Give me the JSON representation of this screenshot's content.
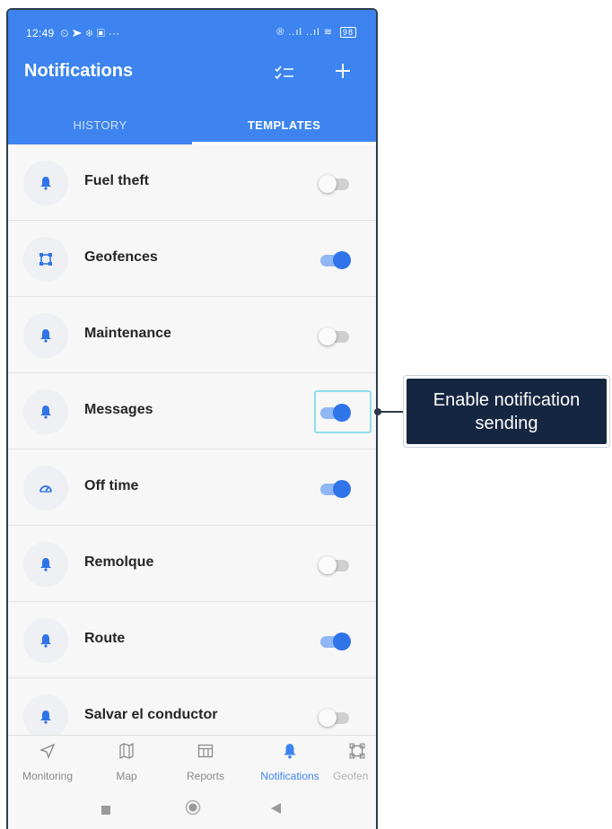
{
  "status_bar": {
    "time": "12:49",
    "left_icons": "⏲ ➤ ❄ ▣ ···",
    "right_icons": "® ..ıl ..ıl ≋",
    "battery": "98"
  },
  "header": {
    "title": "Notifications",
    "checklist_icon": "checklist-icon",
    "add_icon": "plus-icon"
  },
  "tabs": [
    {
      "label": "HISTORY",
      "active": false
    },
    {
      "label": "TEMPLATES",
      "active": true
    }
  ],
  "templates": [
    {
      "label": "Fuel theft",
      "icon": "bell-icon",
      "enabled": false
    },
    {
      "label": "Geofences",
      "icon": "geofence-icon",
      "enabled": true
    },
    {
      "label": "Maintenance",
      "icon": "bell-icon",
      "enabled": false
    },
    {
      "label": "Messages",
      "icon": "bell-icon",
      "enabled": true
    },
    {
      "label": "Off time",
      "icon": "speedometer-icon",
      "enabled": true
    },
    {
      "label": "Remolque",
      "icon": "bell-icon",
      "enabled": false
    },
    {
      "label": "Route",
      "icon": "bell-icon",
      "enabled": true
    },
    {
      "label": "Salvar el conductor",
      "icon": "bell-icon",
      "enabled": false
    }
  ],
  "bottom_nav": [
    {
      "label": "Monitoring",
      "icon": "navigation-arrow-icon",
      "active": false
    },
    {
      "label": "Map",
      "icon": "map-icon",
      "active": false
    },
    {
      "label": "Reports",
      "icon": "table-icon",
      "active": false
    },
    {
      "label": "Notifications",
      "icon": "bell-icon",
      "active": true
    },
    {
      "label": "Geofen",
      "icon": "geofence-icon",
      "active": false
    }
  ],
  "callout": {
    "line1": "Enable notification",
    "line2": "sending"
  },
  "colors": {
    "primary": "#3d84f0",
    "toggle_on": "#2f74e8",
    "callout_bg": "#152641",
    "highlight": "#8be0ea"
  }
}
